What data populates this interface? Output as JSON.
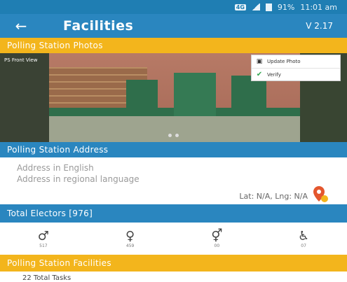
{
  "status_bar": {
    "network": "4G",
    "battery": "91%",
    "time": "11:01 am"
  },
  "app_bar": {
    "title": "Facilities",
    "version": "V 2.17"
  },
  "photos_section": {
    "header": "Polling Station Photos",
    "caption": "PS Front View",
    "actions": [
      {
        "label": "Update Photo",
        "icon": "camera-icon"
      },
      {
        "label": "Verify",
        "icon": "check-icon"
      }
    ]
  },
  "address_section": {
    "header": "Polling Station Address",
    "placeholder_english": "Address in English",
    "placeholder_regional": "Address in regional language",
    "latlng": "Lat: N/A, Lng: N/A"
  },
  "electors_section": {
    "header": "Total Electors [976]",
    "items": [
      {
        "icon": "male-icon",
        "count": "517"
      },
      {
        "icon": "female-icon",
        "count": "459"
      },
      {
        "icon": "third-gender-icon",
        "count": "00"
      },
      {
        "icon": "wheelchair-icon",
        "count": "07"
      }
    ]
  },
  "facilities_section": {
    "header": "Polling Station Facilities",
    "tasks": "22 Total Tasks"
  },
  "colors": {
    "primary": "#2a86bf",
    "accent": "#f3b51c"
  }
}
